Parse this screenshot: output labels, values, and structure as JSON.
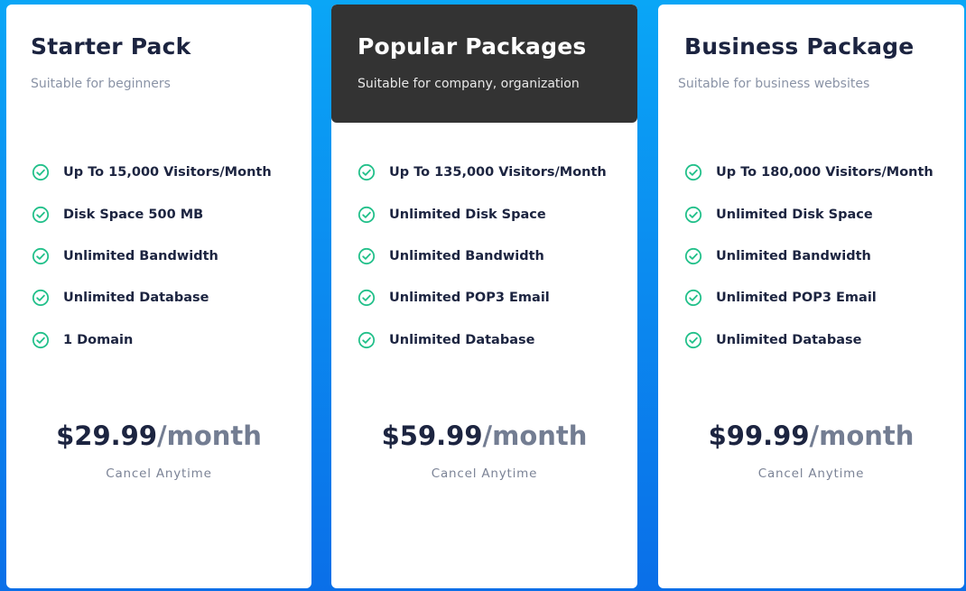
{
  "colors": {
    "accent_check": "#22c08a",
    "highlight_header": "#333333",
    "title_text": "#1c2440",
    "background_top": "#0aa6f6",
    "background_bottom": "#0a6fe8"
  },
  "plans": [
    {
      "title": "Starter Pack",
      "subtitle": "Suitable for beginners",
      "features": [
        "Up To 15,000 Visitors/Month",
        "Disk Space 500 MB",
        "Unlimited Bandwidth",
        "Unlimited Database",
        "1 Domain"
      ],
      "price": "$29.99",
      "period": "/month",
      "note": "Cancel Anytime",
      "icon": "check-circle-icon"
    },
    {
      "title": "Popular Packages",
      "subtitle": "Suitable for company, organization",
      "features": [
        "Up To 135,000 Visitors/Month",
        "Unlimited Disk Space",
        "Unlimited Bandwidth",
        "Unlimited POP3 Email",
        "Unlimited Database"
      ],
      "price": "$59.99",
      "period": "/month",
      "note": "Cancel Anytime",
      "icon": "check-circle-icon"
    },
    {
      "title": "Business Package",
      "subtitle": "Suitable for business websites",
      "features": [
        "Up To 180,000 Visitors/Month",
        "Unlimited Disk Space",
        "Unlimited Bandwidth",
        "Unlimited POP3 Email",
        "Unlimited Database"
      ],
      "price": "$99.99",
      "period": "/month",
      "note": "Cancel Anytime",
      "icon": "check-circle-icon"
    }
  ]
}
